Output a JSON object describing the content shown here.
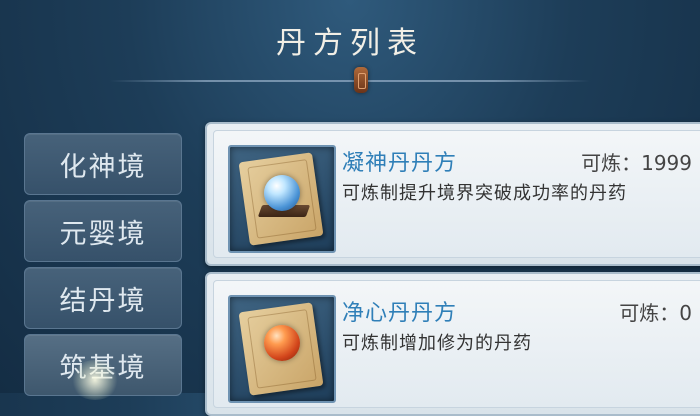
{
  "header": {
    "title": "丹方列表"
  },
  "tabs": [
    {
      "label": "化神境"
    },
    {
      "label": "元婴境"
    },
    {
      "label": "结丹境"
    },
    {
      "label": "筑基境"
    }
  ],
  "recipes": [
    {
      "name": "凝神丹丹方",
      "count_label": "可炼：",
      "count": "1999",
      "description": "可炼制提升境界突破成功率的丹药",
      "orb_icon": "blue-orb-icon"
    },
    {
      "name": "净心丹丹方",
      "count_label": "可炼：",
      "count": "0",
      "description": "可炼制增加修为的丹药",
      "orb_icon": "red-orb-icon"
    }
  ],
  "colors": {
    "recipe_name": "#2f7fb8",
    "background": "#1d3d58",
    "card": "#e8eef3"
  }
}
